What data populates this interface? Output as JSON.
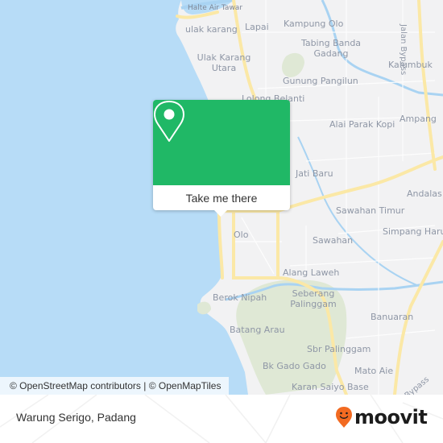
{
  "map": {
    "places": [
      {
        "name": "Halte Air Tawar",
        "kind": "small"
      },
      {
        "name": "Kampung Olo"
      },
      {
        "name": "ulak karang"
      },
      {
        "name": "Lapai"
      },
      {
        "name": "Tabing Banda Gadang"
      },
      {
        "name": "Ulak Karang Utara"
      },
      {
        "name": "Kalumbuk"
      },
      {
        "name": "Gunung Pangilun"
      },
      {
        "name": "Lolong Belanti"
      },
      {
        "name": "Alai Parak Kopi"
      },
      {
        "name": "Ampang"
      },
      {
        "name": "Jati Baru"
      },
      {
        "name": "Andalas"
      },
      {
        "name": "Sawahan Timur"
      },
      {
        "name": "Simpang Haru"
      },
      {
        "name": "Olo"
      },
      {
        "name": "Sawahan"
      },
      {
        "name": "Alang Laweh"
      },
      {
        "name": "Berok Nipah"
      },
      {
        "name": "Seberang Palinggam"
      },
      {
        "name": "Banuaran"
      },
      {
        "name": "Batang Arau"
      },
      {
        "name": "Sbr Palinggam"
      },
      {
        "name": "Bk Gado Gado"
      },
      {
        "name": "Mato Aie"
      },
      {
        "name": "Karan Saiyo Base"
      }
    ],
    "road_labels": [
      "Jalan Bypass",
      "Bypass"
    ],
    "colors": {
      "sea": "#b7dcf7",
      "land": "#f2f2f3",
      "park": "#dfe8d5",
      "major_road": "#fbe8a6",
      "river": "#a9d3f2"
    }
  },
  "popup": {
    "icon": "map-pin-icon",
    "button_label": "Take me there",
    "color": "#20b866"
  },
  "attribution": "© OpenStreetMap contributors | © OpenMapTiles",
  "footer": {
    "title": "Warung Serigo, Padang",
    "logo_text": "moovit",
    "logo_color": "#f26a21"
  }
}
